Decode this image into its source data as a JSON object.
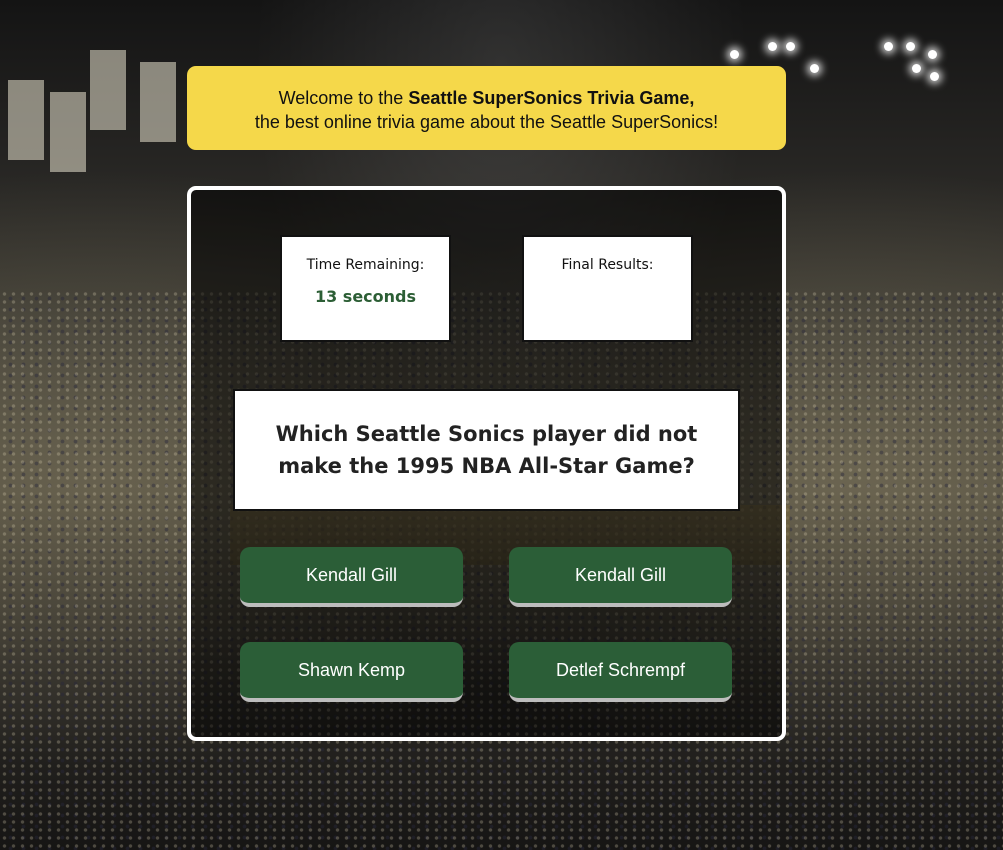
{
  "welcome": {
    "line1_prefix": "Welcome to the",
    "game_name": "Seattle SuperSonics Trivia Game,",
    "line2": "the best online trivia game about the Seattle SuperSonics!"
  },
  "timer": {
    "label": "Time Remaining:",
    "value": "13 seconds"
  },
  "results": {
    "label": "Final Results:",
    "value": ""
  },
  "question": {
    "text": "Which Seattle Sonics player did not make the 1995 NBA All-Star Game?"
  },
  "answers": [
    {
      "label": "Kendall Gill"
    },
    {
      "label": "Kendall Gill"
    },
    {
      "label": "Shawn Kemp"
    },
    {
      "label": "Detlef Schrempf"
    }
  ],
  "colors": {
    "welcome_bg": "#f5d84a",
    "answer_bg": "#2b5e37",
    "timer_text": "#2c5e35"
  }
}
